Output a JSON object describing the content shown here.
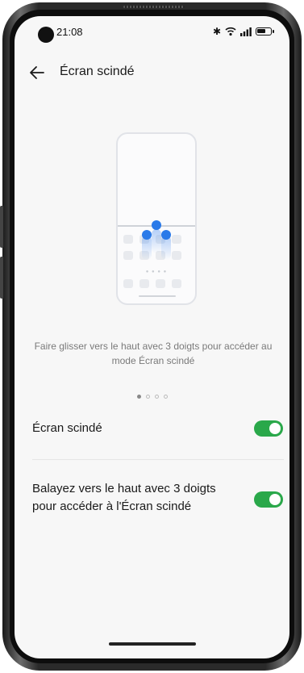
{
  "status_bar": {
    "time": "21:08",
    "icons": [
      "bluetooth-icon",
      "wifi-icon",
      "signal-icon",
      "battery-icon"
    ],
    "battery_level": 0.7
  },
  "header": {
    "back_icon": "arrow-left-icon",
    "title": "Écran scindé"
  },
  "illustration": {
    "icon": "three-finger-swipe-illustration",
    "accent_color": "#2a7ae9"
  },
  "description": {
    "line1": "Faire glisser vers le haut avec 3 doigts pour accéder au",
    "line2": "mode Écran scindé"
  },
  "pager": {
    "pages": 4,
    "active": 1
  },
  "settings": [
    {
      "label": "Écran scindé",
      "enabled": true
    },
    {
      "label_line1": "Balayez vers le haut avec 3 doigts",
      "label_line2": "pour accéder à l'Écran scindé",
      "enabled": true
    }
  ],
  "colors": {
    "toggle_on": "#2aa84a",
    "background": "#f7f7f7"
  }
}
